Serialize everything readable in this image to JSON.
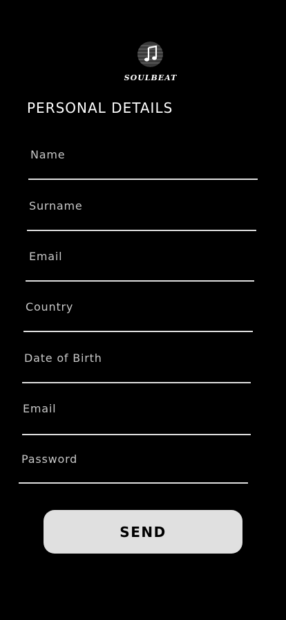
{
  "brand": {
    "logo_icon": "music-note-icon",
    "name": "SOULBEAT"
  },
  "page": {
    "title": "PERSONAL DETAILS"
  },
  "form": {
    "fields": [
      {
        "label": "Name"
      },
      {
        "label": "Surname"
      },
      {
        "label": "Email"
      },
      {
        "label": "Country"
      },
      {
        "label": "Date of Birth"
      },
      {
        "label": "Email"
      },
      {
        "label": "Password"
      }
    ],
    "send_label": "SEND"
  },
  "colors": {
    "background": "#000000",
    "text": "#ffffff",
    "label": "#c8c8c8",
    "underline": "#e0e0e0",
    "button": "#e0e0e0",
    "button_text": "#000000"
  }
}
